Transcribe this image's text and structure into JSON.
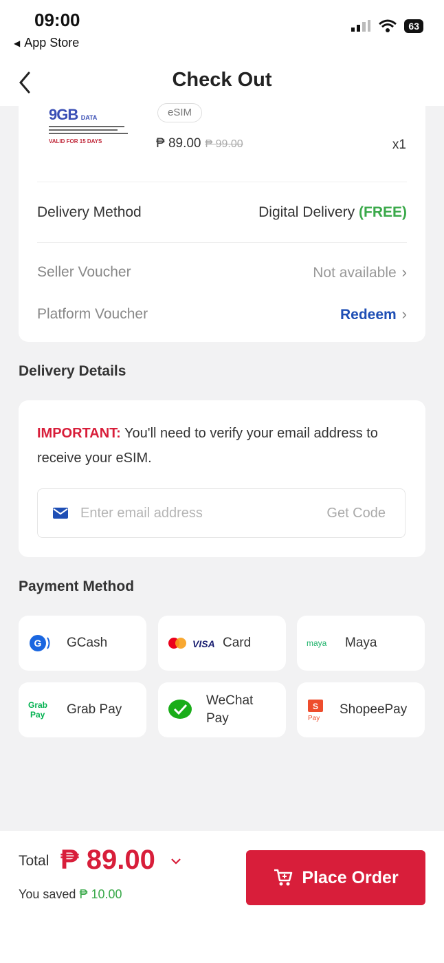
{
  "status_bar": {
    "time": "09:00",
    "back_app": "App Store",
    "battery": "63"
  },
  "header": {
    "title": "Check Out"
  },
  "product": {
    "image_text": "9GB",
    "image_subtext": "DATA",
    "image_valid": "VALID FOR 15 DAYS",
    "tag": "eSIM",
    "price": "₱ 89.00",
    "original_price": "₱ 99.00",
    "quantity": "x1"
  },
  "delivery_method": {
    "label": "Delivery Method",
    "value": "Digital Delivery",
    "free": "(FREE)"
  },
  "seller_voucher": {
    "label": "Seller Voucher",
    "value": "Not available"
  },
  "platform_voucher": {
    "label": "Platform Voucher",
    "value": "Redeem"
  },
  "delivery_details": {
    "title": "Delivery Details",
    "important_label": "IMPORTANT:",
    "important_text": " You'll need to verify your email address to receive your eSIM.",
    "email_placeholder": "Enter email address",
    "get_code": "Get Code"
  },
  "payment": {
    "title": "Payment Method",
    "methods": [
      {
        "label": "GCash",
        "icon": "gcash-icon"
      },
      {
        "label": "Card",
        "icon": "card-icon"
      },
      {
        "label": "Maya",
        "icon": "maya-icon"
      },
      {
        "label": "Grab Pay",
        "icon": "grabpay-icon"
      },
      {
        "label": "WeChat Pay",
        "icon": "wechat-pay-icon"
      },
      {
        "label": "ShopeePay",
        "icon": "shopeepay-icon"
      }
    ]
  },
  "footer": {
    "total_label": "Total",
    "total_amount": "₱ 89.00",
    "saved_label": "You saved",
    "saved_amount": "₱ 10.00",
    "place_order": "Place Order"
  },
  "colors": {
    "accent": "#d81e3a",
    "link": "#1f4fb5",
    "free": "#3aa94a",
    "background": "#f2f2f3"
  }
}
